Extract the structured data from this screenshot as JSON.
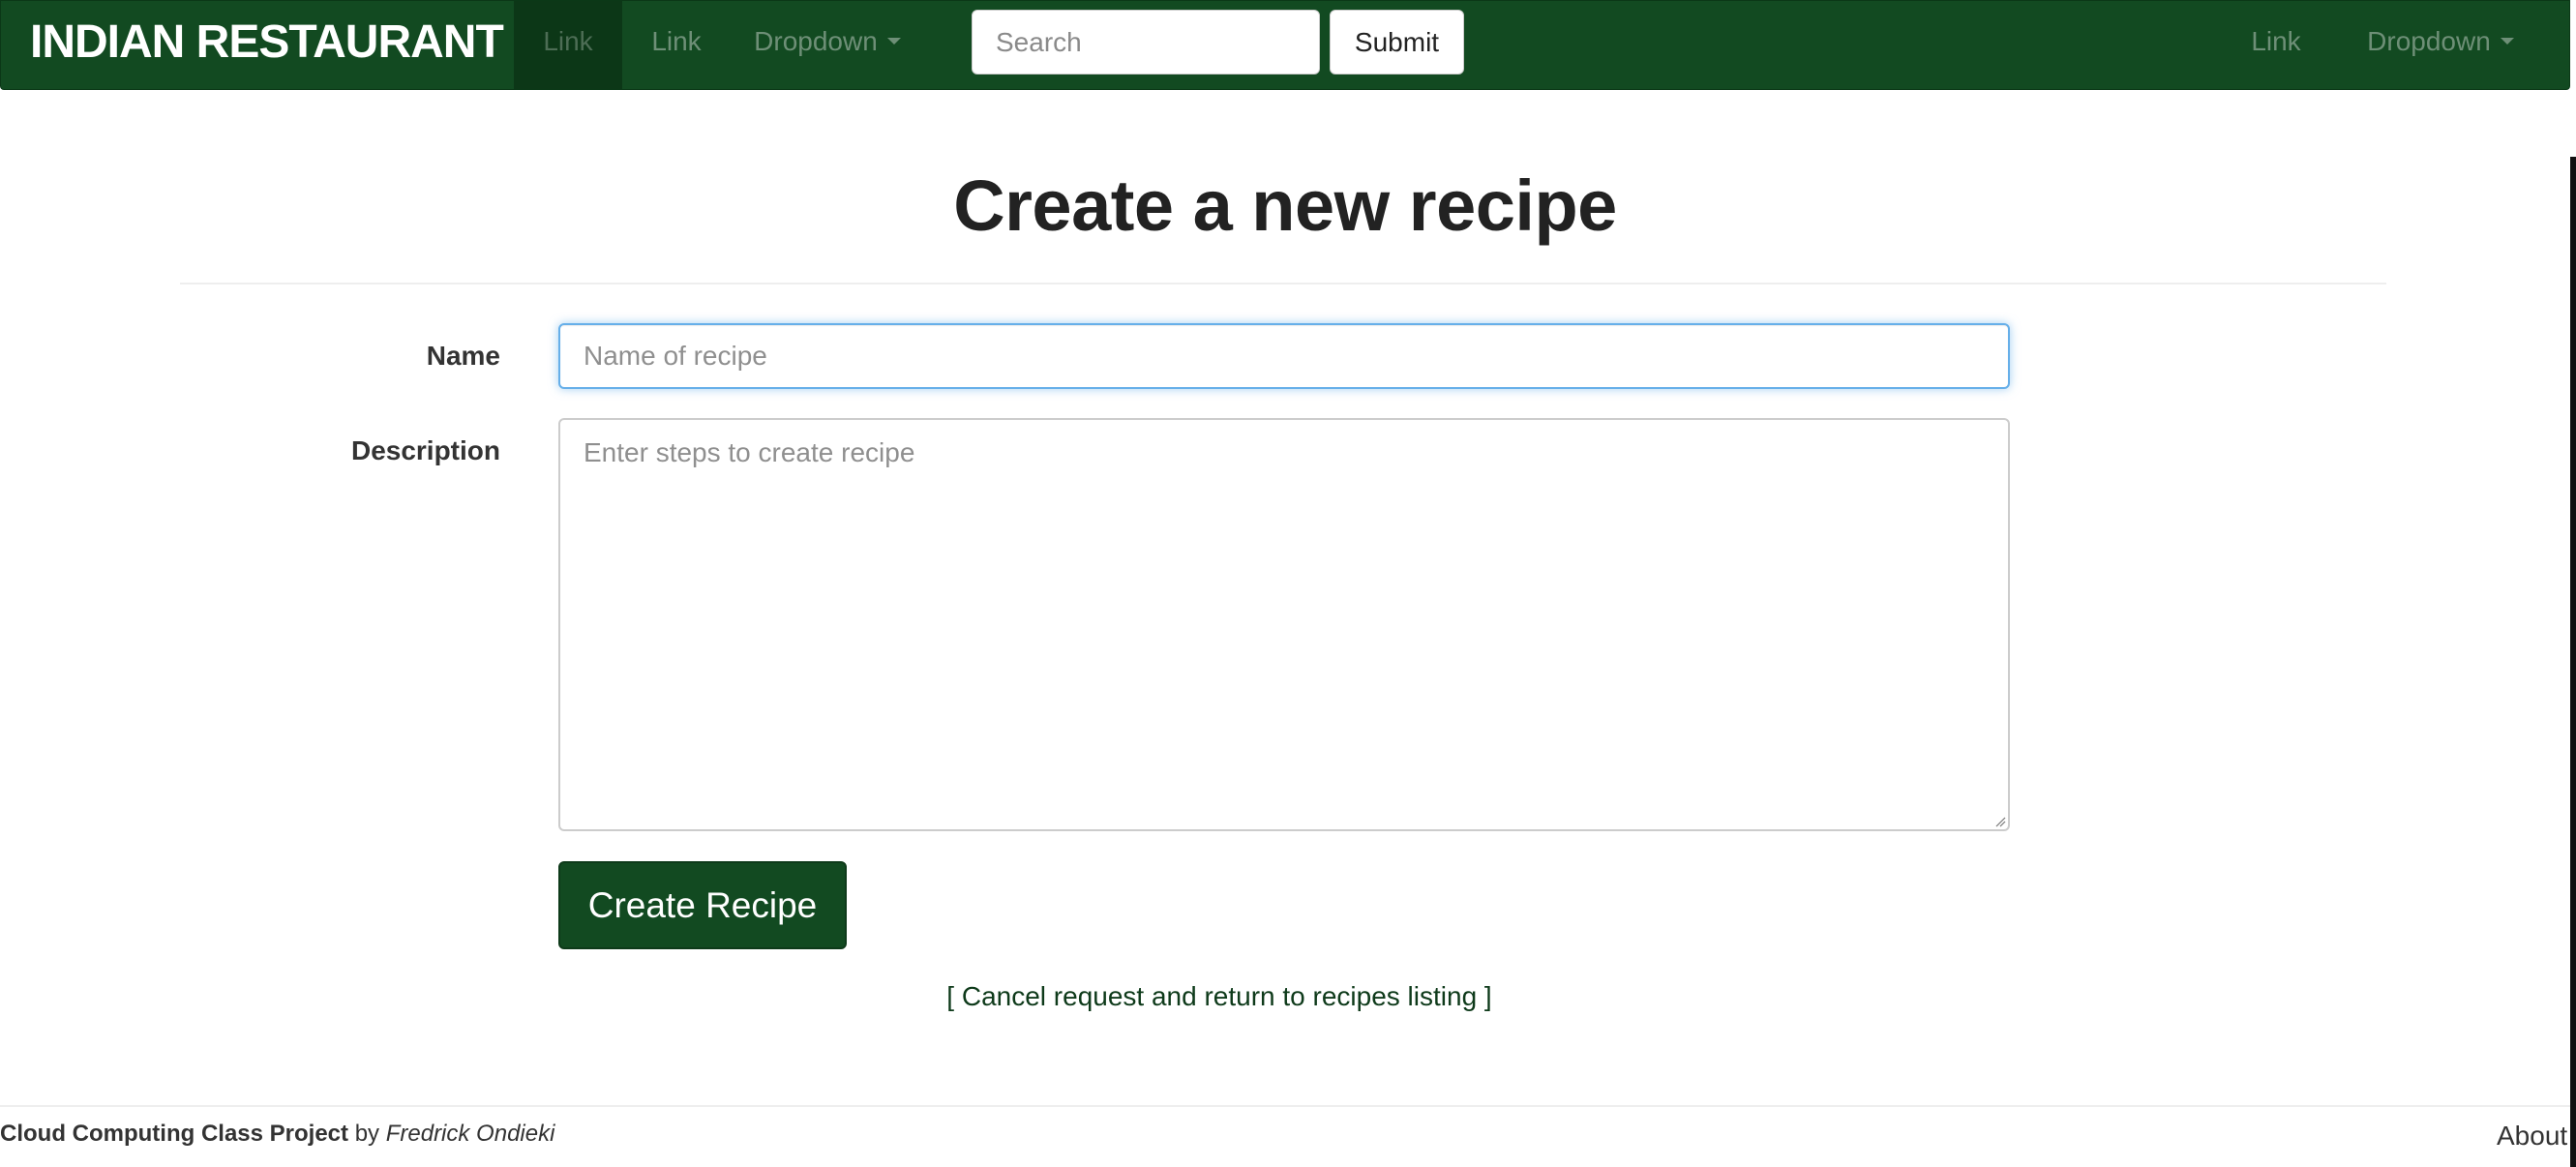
{
  "navbar": {
    "brand": "INDIAN RESTAURANT",
    "left_links": [
      "Link",
      "Link"
    ],
    "left_dropdown": "Dropdown",
    "search_placeholder": "Search",
    "submit_label": "Submit",
    "right_link": "Link",
    "right_dropdown": "Dropdown",
    "active_index": 0
  },
  "main": {
    "title": "Create a new recipe",
    "name_label": "Name",
    "name_placeholder": "Name of recipe",
    "name_value": "",
    "description_label": "Description",
    "description_placeholder": "Enter steps to create recipe",
    "description_value": "",
    "create_button": "Create Recipe",
    "cancel_link": "[ Cancel request and return to recipes listing ]"
  },
  "footer": {
    "project": "Cloud Computing Class Project",
    "by": " by ",
    "author": "Fredrick Ondieki",
    "about": "About"
  },
  "colors": {
    "navbar_bg": "#124a21",
    "focus_ring": "#66afe9",
    "button_bg": "#124a21"
  }
}
